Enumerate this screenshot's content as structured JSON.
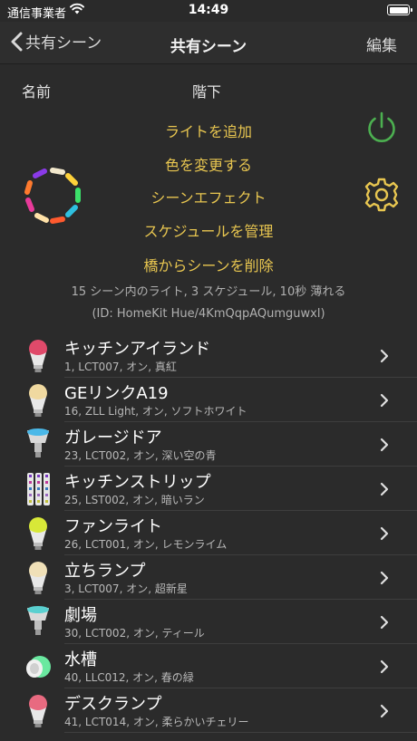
{
  "status": {
    "carrier": "通信事業者",
    "time": "14:49"
  },
  "nav": {
    "back_label": "共有シーン",
    "title": "共有シーン",
    "edit_label": "編集"
  },
  "scene": {
    "name_label": "名前",
    "floor_label": "階下",
    "actions": [
      "ライトを追加",
      "色を変更する",
      "シーンエフェクト",
      "スケジュールを管理",
      "橋からシーンを削除"
    ],
    "summary": "15 シーン内のライト, 3 スケジュール, 10秒 薄れる",
    "id_text": "(ID: HomeKit Hue/4KmQqpAQumguwxl)"
  },
  "colors": {
    "accent": "#e8c650",
    "power": "#4caf50",
    "background": "#2b2b2b"
  },
  "lights": [
    {
      "name": "キッチンアイランド",
      "detail": "1, LCT007, オン, 真紅",
      "icon": "bulb-icon",
      "color": "#e04a6a"
    },
    {
      "name": "GEリンクA19",
      "detail": "16, ZLL Light, オン, ソフトホワイト",
      "icon": "bulb-icon",
      "color": "#f0d9a0"
    },
    {
      "name": "ガレージドア",
      "detail": "23, LCT002, オン, 深い空の青",
      "icon": "downlight-icon",
      "color": "#4ab8e8"
    },
    {
      "name": "キッチンストリップ",
      "detail": "25, LST002, オン, 暗いラン",
      "icon": "lightstrip-icon",
      "color": "#9a6ac0"
    },
    {
      "name": "ファンライト",
      "detail": "26, LCT001, オン, レモンライム",
      "icon": "bulb-icon",
      "color": "#d8e838"
    },
    {
      "name": "立ちランプ",
      "detail": "3, LCT007, オン, 超新星",
      "icon": "bulb-icon",
      "color": "#f0e0b8"
    },
    {
      "name": "劇場",
      "detail": "30, LCT002, オン, ティール",
      "icon": "downlight-icon",
      "color": "#5ad0d0"
    },
    {
      "name": "水槽",
      "detail": "40, LLC012, オン, 春の緑",
      "icon": "bloom-icon",
      "color": "#6ae8a0"
    },
    {
      "name": "デスクランプ",
      "detail": "41, LCT014, オン, 柔らかいチェリー",
      "icon": "bulb-icon",
      "color": "#e86a80"
    }
  ]
}
